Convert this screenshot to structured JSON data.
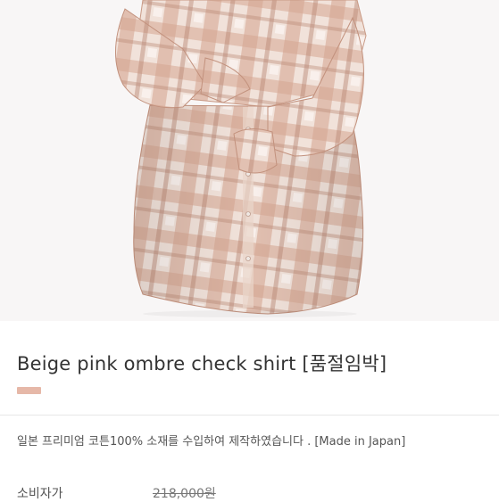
{
  "product": {
    "title": "Beige pink ombre check shirt [품절임박]",
    "swatch_color": "#e6b8a8",
    "description": "일본 프리미엄 코튼100% 소재를 수입하여 제작하였습니다 . [Made in Japan]",
    "price_label": "소비자가",
    "price_value": "218,000원"
  },
  "image": {
    "subject": "beige-pink-plaid-shirt-photo",
    "colors": {
      "background": "#f8f6f6",
      "plaid_light": "#f3e6df",
      "plaid_mid": "#dcb4a2",
      "plaid_dark": "#b98672"
    }
  }
}
